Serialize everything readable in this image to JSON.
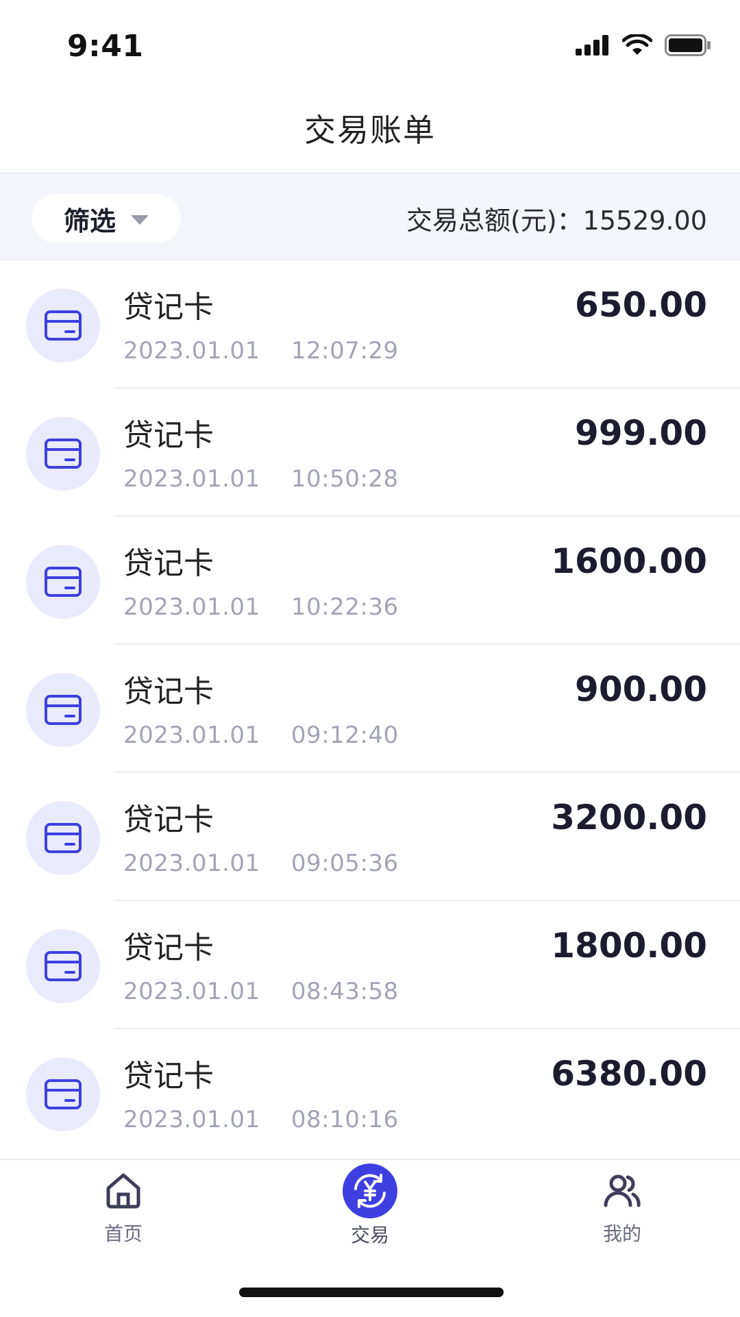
{
  "status": {
    "time": "9:41"
  },
  "header": {
    "title": "交易账单"
  },
  "filter": {
    "label": "筛选",
    "total_label": "交易总额(元)：",
    "total_value": "15529.00"
  },
  "transactions": [
    {
      "name": "贷记卡",
      "datetime": "2023.01.01    12:07:29",
      "amount": "650.00"
    },
    {
      "name": "贷记卡",
      "datetime": "2023.01.01    10:50:28",
      "amount": "999.00"
    },
    {
      "name": "贷记卡",
      "datetime": "2023.01.01    10:22:36",
      "amount": "1600.00"
    },
    {
      "name": "贷记卡",
      "datetime": "2023.01.01    09:12:40",
      "amount": "900.00"
    },
    {
      "name": "贷记卡",
      "datetime": "2023.01.01    09:05:36",
      "amount": "3200.00"
    },
    {
      "name": "贷记卡",
      "datetime": "2023.01.01    08:43:58",
      "amount": "1800.00"
    },
    {
      "name": "贷记卡",
      "datetime": "2023.01.01    08:10:16",
      "amount": "6380.00"
    }
  ],
  "tabbar": {
    "items": [
      {
        "label": "首页",
        "icon": "home-icon"
      },
      {
        "label": "交易",
        "icon": "yuan-exchange-icon",
        "active": true
      },
      {
        "label": "我的",
        "icon": "users-icon"
      }
    ]
  },
  "colors": {
    "accent": "#3d3fe0",
    "icon_bg": "#e9eafb",
    "muted": "#a3a3b6"
  }
}
